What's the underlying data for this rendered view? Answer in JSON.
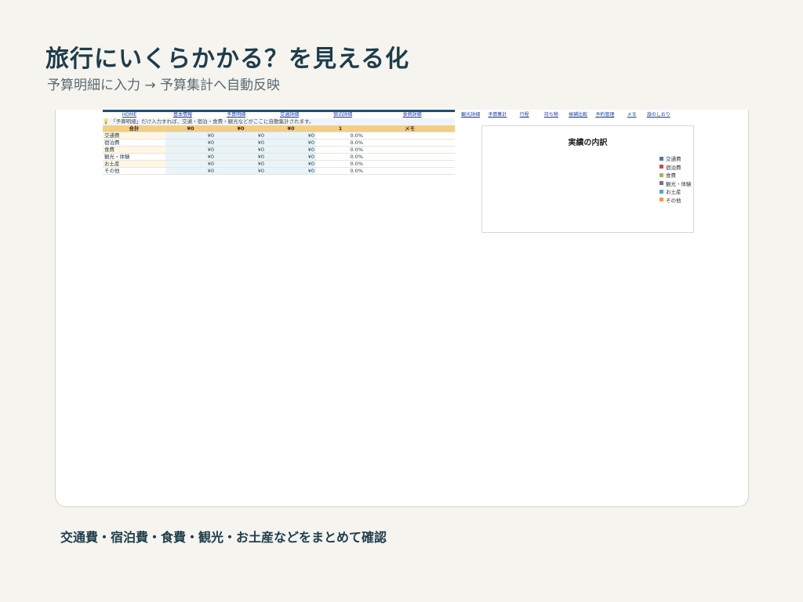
{
  "page": {
    "title": "旅行にいくらかかる？を見える化",
    "subtitle": "予算明細に入力 → 予算集計へ自動反映",
    "caption": "交通費・宿泊費・食費・観光・お土産などをまとめて確認"
  },
  "nav_primary": [
    "HOME",
    "基本情報",
    "予算明細",
    "交通詳細",
    "宿泊詳細",
    "食費詳細"
  ],
  "nav_secondary": [
    "観光詳細",
    "予算集計",
    "行程",
    "持ち物",
    "候補比較",
    "予約管理",
    "メモ",
    "旅のしおり"
  ],
  "notice": "「予算明細」だけ入力すれば、交通・宿泊・食費・観光などがここに自動集計されます。",
  "table": {
    "header": [
      "合計",
      "¥0",
      "¥0",
      "¥0",
      "1",
      "メモ"
    ],
    "rows": [
      {
        "label": "交通費",
        "a": "¥0",
        "b": "¥0",
        "c": "¥0",
        "pct": "0.0%"
      },
      {
        "label": "宿泊費",
        "a": "¥0",
        "b": "¥0",
        "c": "¥0",
        "pct": "0.0%"
      },
      {
        "label": "食費",
        "a": "¥0",
        "b": "¥0",
        "c": "¥0",
        "pct": "0.0%"
      },
      {
        "label": "観光・体験",
        "a": "¥0",
        "b": "¥0",
        "c": "¥0",
        "pct": "0.0%"
      },
      {
        "label": "お土産",
        "a": "¥0",
        "b": "¥0",
        "c": "¥0",
        "pct": "0.0%"
      },
      {
        "label": "その他",
        "a": "¥0",
        "b": "¥0",
        "c": "¥0",
        "pct": "0.0%"
      }
    ]
  },
  "chart": {
    "title": "実績の内訳",
    "legend": [
      {
        "name": "交通費",
        "color": "#4e79a7"
      },
      {
        "name": "宿泊費",
        "color": "#c0504d"
      },
      {
        "name": "食費",
        "color": "#9bbb59"
      },
      {
        "name": "観光・体験",
        "color": "#8064a2"
      },
      {
        "name": "お土産",
        "color": "#4bacc6"
      },
      {
        "name": "その他",
        "color": "#f79646"
      }
    ]
  }
}
